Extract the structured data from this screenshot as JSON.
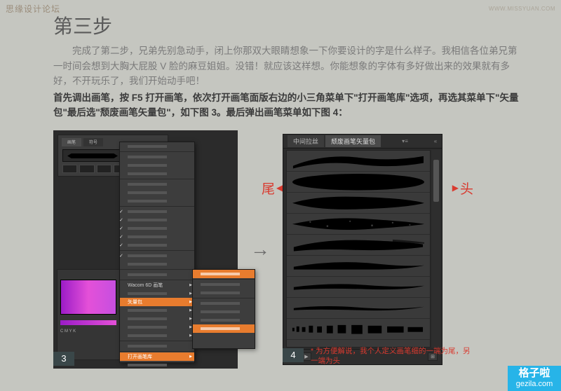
{
  "watermark": {
    "top_left": "思缘设计论坛",
    "top_right": "WWW.MISSYUAN.COM"
  },
  "title": "第三步",
  "paragraph1": "完成了第二步，兄弟先别急动手，闭上你那双大眼睛想象一下你要设计的字是什么样子。我相信各位弟兄第一时间会想到大胸大屁股 V 脸的麻豆姐姐。没错！就应该这样想。你能想象的字体有多好做出来的效果就有多好，不开玩乐了，我们开始动手吧！",
  "paragraph2": "首先调出画笔，按 F5 打开画笔，依次打开画笔面版右边的小三角菜单下\"打开画笔库\"选项，再选其菜单下\"矢量包\"最后选\"颓废画笔矢量包\"，如下图 3。最后弹出画笔菜单如下图 4：",
  "step_labels": {
    "left": "3",
    "right": "4"
  },
  "arrow": "→",
  "side_markers": {
    "tail": "尾",
    "head": "头"
  },
  "right_panel": {
    "tab1": "中间拉丝",
    "tab2": "颓废画笔矢量包"
  },
  "left_panel": {
    "menu1_items": [
      "Wacom 6D 画笔"
    ],
    "highlighted1": "矢量包",
    "highlighted2": "打开画笔库",
    "color_hint": "C M Y K"
  },
  "footnote": "* 为方便解说，我个人定义画笔细的一端为尾，另一端为头",
  "gezila": {
    "line1": "格子啦",
    "line2": "gezila.com"
  }
}
